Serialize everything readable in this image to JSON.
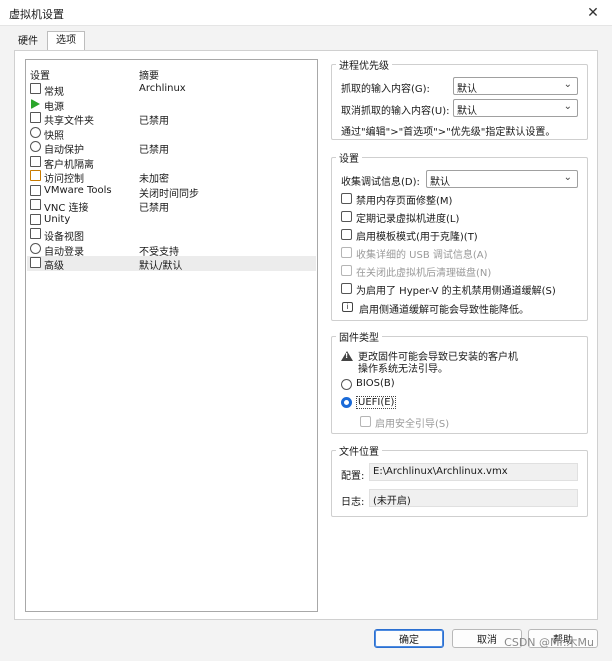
{
  "window": {
    "title": "虚拟机设置",
    "close_glyph": "✕"
  },
  "tabs": [
    {
      "label": "硬件"
    },
    {
      "label": "选项"
    }
  ],
  "list": {
    "headers": {
      "setting": "设置",
      "summary": "摘要"
    },
    "rows": [
      {
        "label": "常规",
        "summary": "Archlinux",
        "icon": "monitor-icon"
      },
      {
        "label": "电源",
        "summary": "",
        "icon": "play-icon"
      },
      {
        "label": "共享文件夹",
        "summary": "已禁用",
        "icon": "shared-folder-icon"
      },
      {
        "label": "快照",
        "summary": "",
        "icon": "snapshot-icon"
      },
      {
        "label": "自动保护",
        "summary": "已禁用",
        "icon": "clock-icon"
      },
      {
        "label": "客户机隔离",
        "summary": "",
        "icon": "isolation-icon"
      },
      {
        "label": "访问控制",
        "summary": "未加密",
        "icon": "lock-icon"
      },
      {
        "label": "VMware Tools",
        "summary": "关闭时间同步",
        "icon": "vmware-tools-icon"
      },
      {
        "label": "VNC 连接",
        "summary": "已禁用",
        "icon": "vnc-icon"
      },
      {
        "label": "Unity",
        "summary": "",
        "icon": "unity-icon"
      },
      {
        "label": "设备视图",
        "summary": "",
        "icon": "device-view-icon"
      },
      {
        "label": "自动登录",
        "summary": "不受支持",
        "icon": "user-icon"
      },
      {
        "label": "高级",
        "summary": "默认/默认",
        "icon": "advanced-icon"
      }
    ]
  },
  "priority": {
    "title": "进程优先级",
    "grab_label": "抓取的输入内容(G):",
    "grab_value": "默认",
    "ungrab_label": "取消抓取的输入内容(U):",
    "ungrab_value": "默认",
    "note": "通过\"编辑\">\"首选项\">\"优先级\"指定默认设置。"
  },
  "settings": {
    "title": "设置",
    "debug_label": "收集调试信息(D):",
    "debug_value": "默认",
    "checkboxes": [
      {
        "label": "禁用内存页面修整(M)"
      },
      {
        "label": "定期记录虚拟机进度(L)"
      },
      {
        "label": "启用模板模式(用于克隆)(T)"
      },
      {
        "label": "收集详细的 USB 调试信息(A)"
      },
      {
        "label": "在关闭此虚拟机后清理磁盘(N)"
      },
      {
        "label": "为启用了 Hyper-V 的主机禁用侧通道缓解(S)"
      }
    ],
    "info": "启用侧通道缓解可能会导致性能降低。"
  },
  "firmware": {
    "title": "固件类型",
    "warning_line1": "更改固件可能会导致已安装的客户机",
    "warning_line2": "操作系统无法引导。",
    "bios_label": "BIOS(B)",
    "uefi_label": "UEFI(E)",
    "secure_boot_label": "启用安全引导(S)"
  },
  "file_location": {
    "title": "文件位置",
    "config_label": "配置:",
    "config_value": "E:\\Archlinux\\Archlinux.vmx",
    "log_label": "日志:",
    "log_value": "(未开启)"
  },
  "buttons": {
    "ok": "确定",
    "cancel": "取消",
    "help": "帮助"
  },
  "watermark": "CSDN @Mr.木Mu"
}
